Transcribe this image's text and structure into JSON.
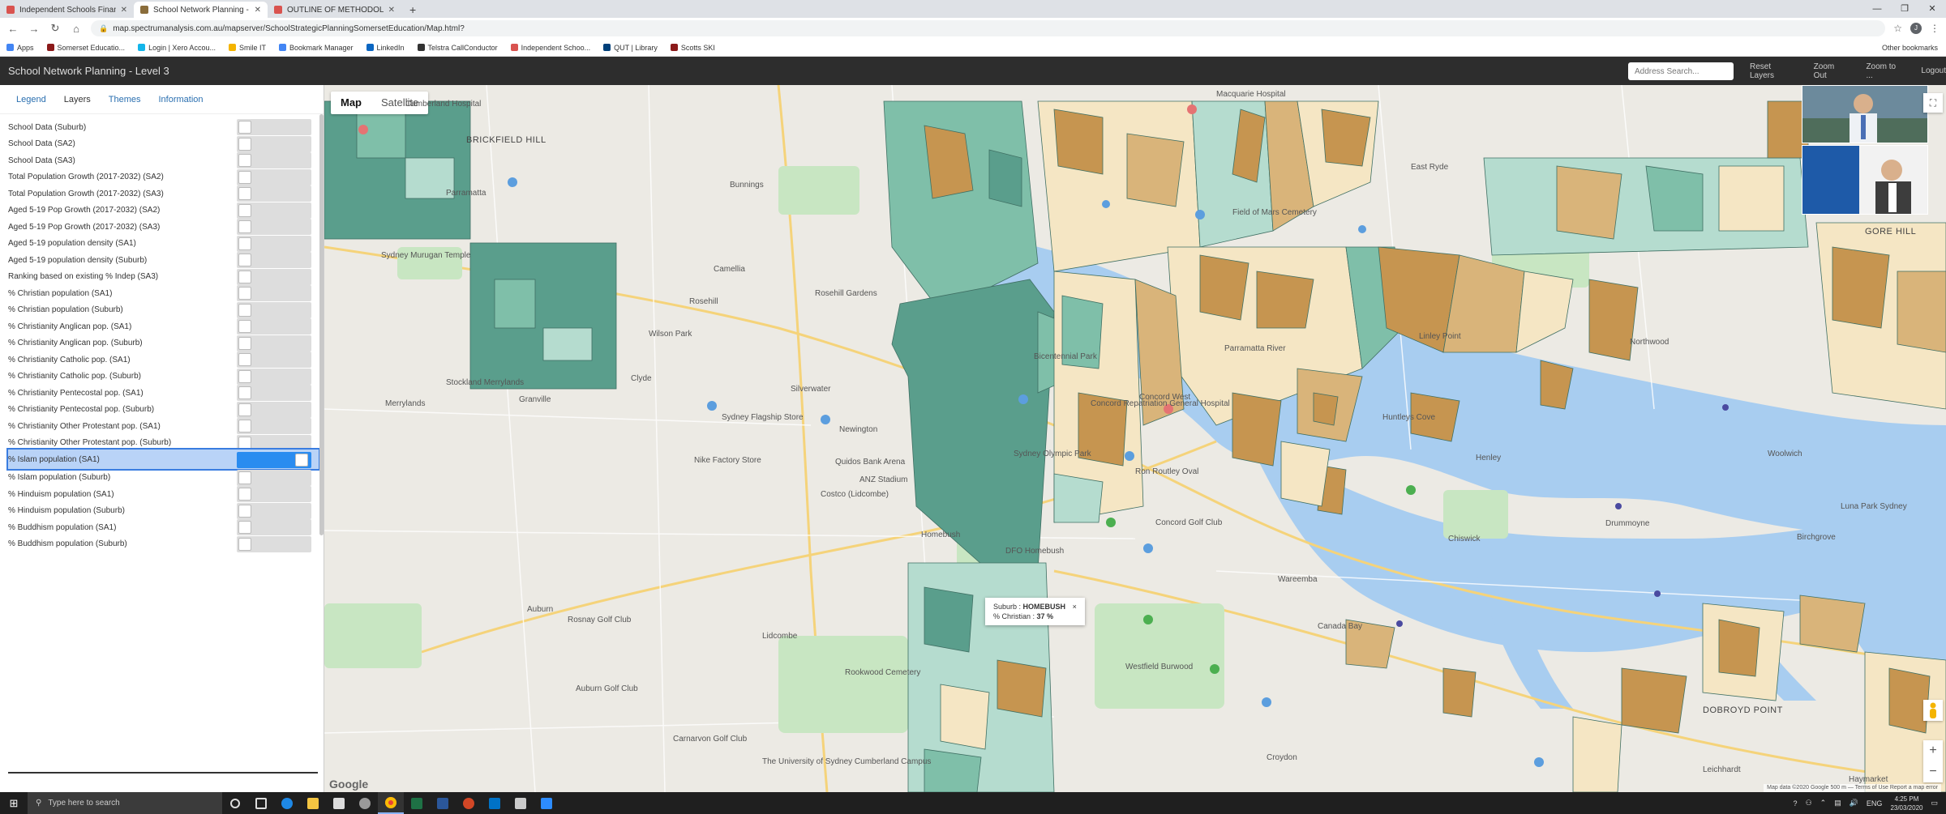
{
  "browser": {
    "tabs": [
      {
        "title": "Independent Schools Financial R",
        "color": "#d9534f",
        "active": false
      },
      {
        "title": "School Network Planning - Leve",
        "color": "#8a6d3b",
        "active": true
      },
      {
        "title": "OUTLINE OF METHODOLOGY AI",
        "color": "#d9534f",
        "active": false
      }
    ],
    "url": "map.spectrumanalysis.com.au/mapserver/SchoolStrategicPlanningSomersetEducation/Map.html?",
    "profile_initial": "J",
    "bookmarks": [
      {
        "label": "Apps",
        "color": "#4285f4"
      },
      {
        "label": "Somerset Educatio...",
        "color": "#8b1a1a"
      },
      {
        "label": "Login | Xero Accou...",
        "color": "#13b5ea"
      },
      {
        "label": "Smile IT",
        "color": "#f4b400"
      },
      {
        "label": "Bookmark Manager",
        "color": "#4285f4"
      },
      {
        "label": "LinkedIn",
        "color": "#0a66c2"
      },
      {
        "label": "Telstra CallConductor",
        "color": "#333333"
      },
      {
        "label": "Independent Schoo...",
        "color": "#d9534f"
      },
      {
        "label": "QUT | Library",
        "color": "#00407a"
      },
      {
        "label": "Scotts SKI",
        "color": "#8b1a1a"
      }
    ],
    "other_bookmarks": "Other bookmarks"
  },
  "app": {
    "title": "School Network Planning - Level 3",
    "address_search_placeholder": "Address Search...",
    "header_links": [
      "Reset Layers",
      "Zoom Out",
      "Zoom to ...",
      "Logout"
    ]
  },
  "panel": {
    "tabs": [
      "Legend",
      "Layers",
      "Themes",
      "Information"
    ],
    "active_tab": "Layers",
    "layers": [
      {
        "label": "School Data (Suburb)",
        "on": false
      },
      {
        "label": "School Data (SA2)",
        "on": false
      },
      {
        "label": "School Data (SA3)",
        "on": false
      },
      {
        "label": "Total Population Growth (2017-2032) (SA2)",
        "on": false
      },
      {
        "label": "Total Population Growth (2017-2032) (SA3)",
        "on": false
      },
      {
        "label": "Aged 5-19 Pop Growth (2017-2032) (SA2)",
        "on": false
      },
      {
        "label": "Aged 5-19 Pop Growth (2017-2032) (SA3)",
        "on": false
      },
      {
        "label": "Aged 5-19 population density (SA1)",
        "on": false
      },
      {
        "label": "Aged 5-19 population density (Suburb)",
        "on": false
      },
      {
        "label": "Ranking based on existing % Indep (SA3)",
        "on": false
      },
      {
        "label": "% Christian population (SA1)",
        "on": false
      },
      {
        "label": "% Christian population (Suburb)",
        "on": false
      },
      {
        "label": "% Christianity Anglican pop. (SA1)",
        "on": false
      },
      {
        "label": "% Christianity Anglican pop. (Suburb)",
        "on": false
      },
      {
        "label": "% Christianity Catholic pop. (SA1)",
        "on": false
      },
      {
        "label": "% Christianity Catholic pop. (Suburb)",
        "on": false
      },
      {
        "label": "% Christianity Pentecostal pop. (SA1)",
        "on": false
      },
      {
        "label": "% Christianity Pentecostal pop. (Suburb)",
        "on": false
      },
      {
        "label": "% Christianity Other Protestant pop. (SA1)",
        "on": false
      },
      {
        "label": "% Christianity Other Protestant pop. (Suburb)",
        "on": false
      },
      {
        "label": "% Islam population (SA1)",
        "on": true
      },
      {
        "label": "% Islam population (Suburb)",
        "on": false
      },
      {
        "label": "% Hinduism population (SA1)",
        "on": false
      },
      {
        "label": "% Hinduism population (Suburb)",
        "on": false
      },
      {
        "label": "% Buddhism population (SA1)",
        "on": false
      },
      {
        "label": "% Buddhism population (Suburb)",
        "on": false
      }
    ]
  },
  "map": {
    "type_buttons": [
      "Map",
      "Satellite"
    ],
    "active_type": "Map",
    "labels": {
      "cumberland_hospital": "Cumberland Hospital",
      "brickfield_hill": "BRICKFIELD HILL",
      "parramatta": "Parramatta",
      "bunnings": "Bunnings",
      "sydney_murugan": "Sydney Murugan Temple",
      "macquarie_hospital": "Macquarie Hospital",
      "field_of_mars": "Field of Mars Cemetery",
      "east_ryde": "East Ryde",
      "gore_hill": "GORE HILL",
      "camellia": "Camellia",
      "rosehill": "Rosehill",
      "clyde": "Clyde",
      "stockland": "Stockland Merrylands",
      "granville": "Granville",
      "merrylands": "Merrylands",
      "silverwater": "Silverwater",
      "newington": "Newington",
      "concord_hospital": "Concord Repatriation General Hospital",
      "huntleys_cove": "Huntleys Cove",
      "linley_point": "Linley Point",
      "northwood": "Northwood",
      "henley": "Henley",
      "woolwich": "Woolwich",
      "birchgrove": "Birchgrove",
      "chiswick": "Chiswick",
      "drummoyne": "Drummoyne",
      "wareemba": "Wareemba",
      "canada_bay": "Canada Bay",
      "sydney_olympic": "Sydney Olympic Park",
      "auburn": "Auburn",
      "lidcombe": "Lidcombe",
      "rookwood": "Rookwood Cemetery",
      "westfield": "Westfield Burwood",
      "croydon": "Croydon",
      "dobroyd": "DOBROYD POINT",
      "leichhardt": "Leichhardt",
      "haymarket": "Haymarket",
      "luna_park": "Luna Park Sydney",
      "camarvon": "Carnarvon Golf Club",
      "uni_sydney": "The University of Sydney Cumberland Campus",
      "ikea": "Sydney Flagship Store",
      "costco": "Costco (Lidcombe)",
      "nike": "Nike Factory Store",
      "bicentennial": "Bicentennial Park",
      "quidos": "Quidos Bank Arena",
      "anz": "ANZ Stadium",
      "dfo": "DFO Homebush",
      "homebush": "Homebush",
      "rosehill_gardens": "Rosehill Gardens",
      "wilson_park": "Wilson Park",
      "ron_routley": "Ron Routley Oval",
      "concord_golf": "Concord Golf Club",
      "concord_west": "Concord West",
      "auburn_golf": "Auburn Golf Club",
      "granville_golf": "Rosnay Golf Club",
      "parramatta_river": "Parramatta River"
    },
    "tooltip": {
      "suburb_label": "Suburb :",
      "suburb_value": "HOMEBUSH",
      "metric_label": "% Christian :",
      "metric_value": "37 %",
      "close": "×"
    },
    "footer": "Map data ©2020 Google   500 m ⎯⎯   Terms of Use   Report a map error",
    "google_logo": "Google",
    "colors": {
      "dark_teal": "#5a9e8c",
      "teal": "#7fbfa9",
      "light_teal": "#b5dccf",
      "cream": "#f5e6c4",
      "tan": "#d9b47a",
      "brown": "#c69550",
      "water": "#a8cdf0"
    }
  },
  "taskbar": {
    "search_placeholder": "Type here to search",
    "time": "4:25 PM",
    "date": "23/03/2020",
    "lang": "ENG"
  }
}
